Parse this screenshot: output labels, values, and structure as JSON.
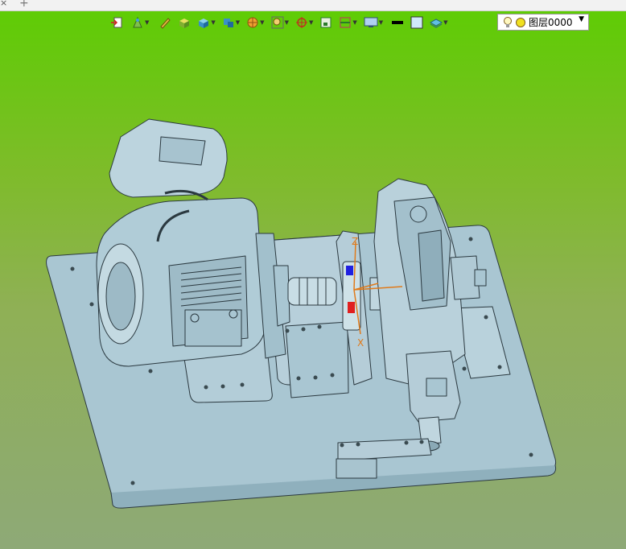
{
  "tabstrip": {
    "close_glyph": "×",
    "add_glyph": "+"
  },
  "toolbar": {
    "buttons": [
      {
        "icon": "exit-sketch-icon",
        "has_menu": false
      },
      {
        "icon": "view-visibility-icon",
        "has_menu": true
      },
      {
        "icon": "pen-tool-icon",
        "has_menu": false
      },
      {
        "icon": "shaded-solid-icon",
        "has_menu": false
      },
      {
        "icon": "cube-icon",
        "has_menu": true
      },
      {
        "icon": "views-icon",
        "has_menu": true
      },
      {
        "icon": "render-sphere-icon",
        "has_menu": true
      },
      {
        "icon": "zoom-fit-icon",
        "has_menu": true
      },
      {
        "icon": "orient-icon",
        "has_menu": true
      },
      {
        "icon": "image-frame-icon",
        "has_menu": false
      },
      {
        "icon": "section-icon",
        "has_menu": true
      },
      {
        "icon": "monitor-display-icon",
        "has_menu": true
      },
      {
        "icon": "line-color-icon",
        "has_menu": false
      },
      {
        "icon": "fill-color-icon",
        "has_menu": false
      },
      {
        "icon": "layer-manager-icon",
        "has_menu": true
      }
    ],
    "layer": {
      "label": "图层0000",
      "bulb_icon": "lightbulb-icon",
      "status_icon": "layer-status-icon"
    }
  },
  "triad": {
    "z_label": "Z",
    "x_label": "X"
  },
  "colors": {
    "model": "#a9c6d2",
    "edge": "#2b3940",
    "accent_red": "#e02020",
    "accent_blue": "#2020e0",
    "axis": "#e07a1a"
  }
}
